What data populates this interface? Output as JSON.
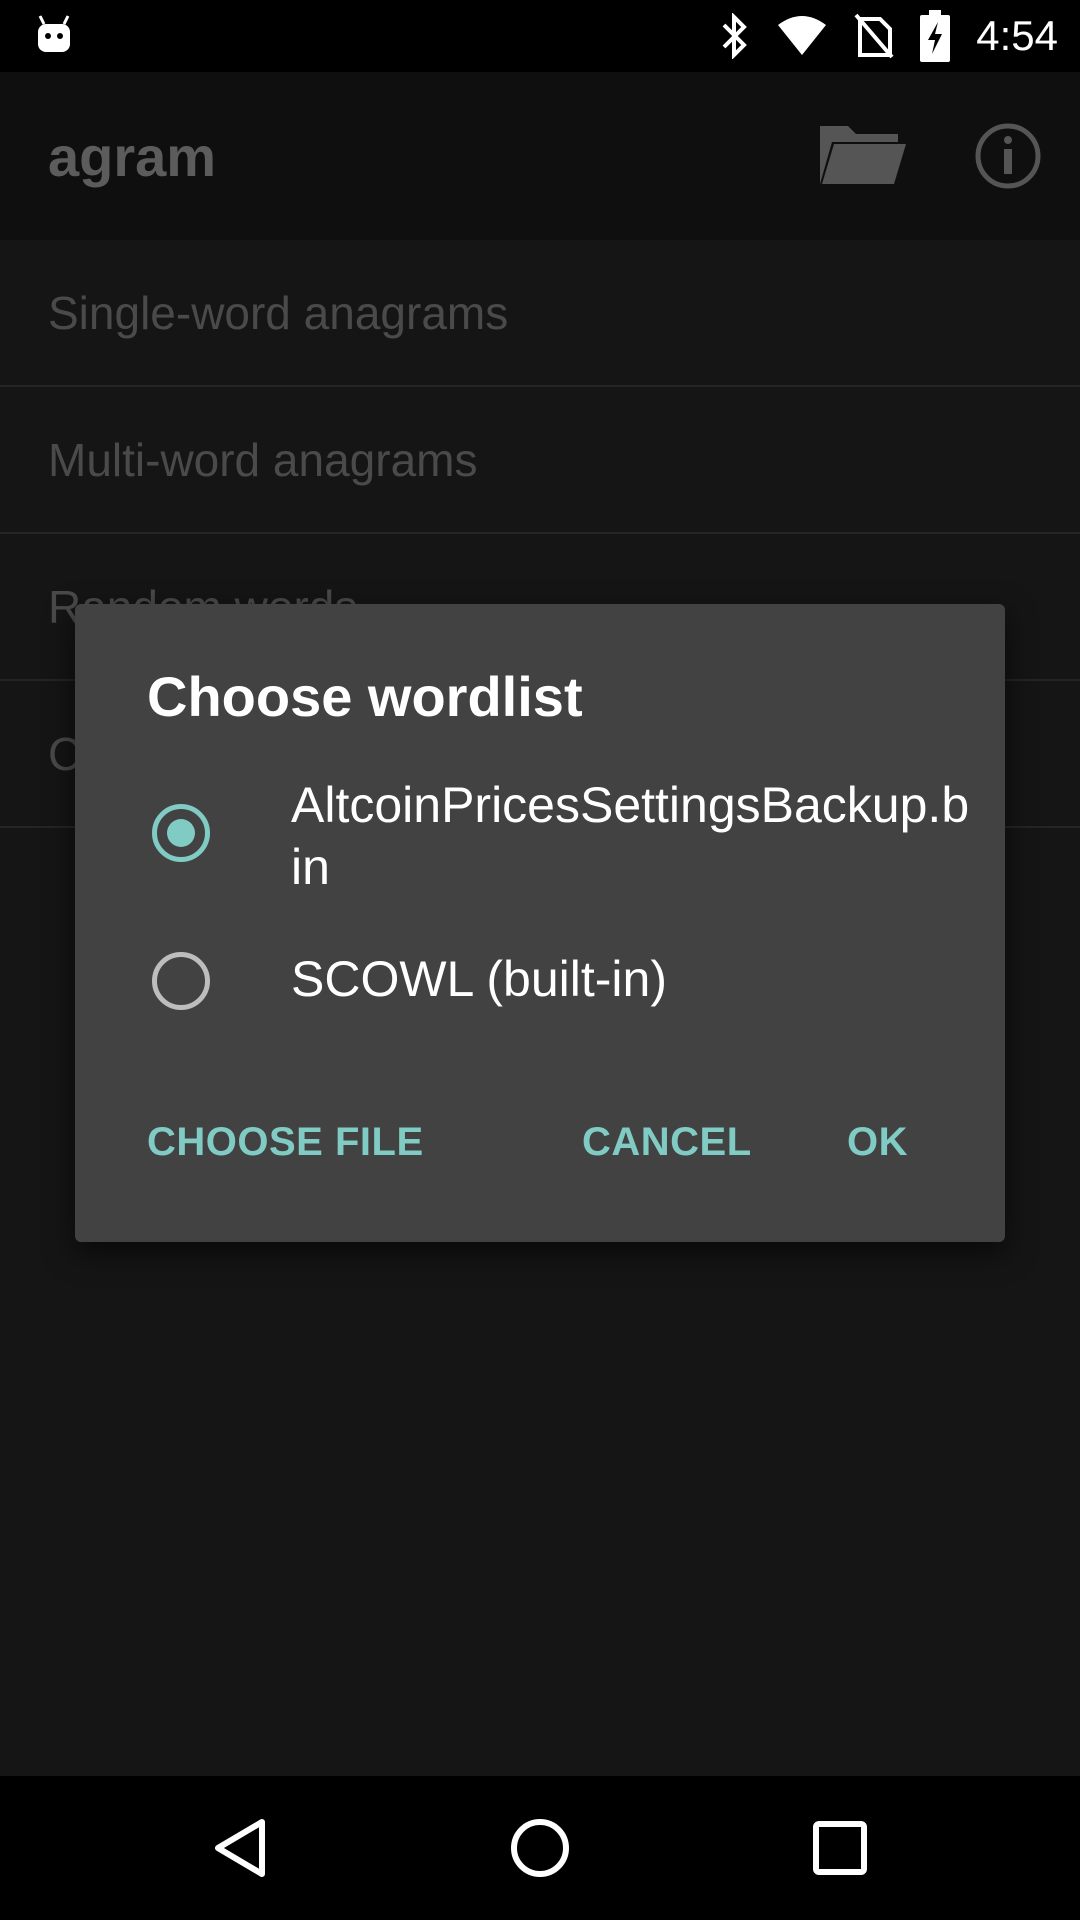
{
  "status_bar": {
    "time": "4:54",
    "icons": [
      "android-notification-icon",
      "bluetooth-icon",
      "wifi-icon",
      "no-sim-icon",
      "battery-charging-icon"
    ]
  },
  "app_bar": {
    "title": "agram",
    "actions": [
      "folder-icon",
      "info-icon"
    ]
  },
  "list": {
    "items": [
      {
        "label": "Single-word anagrams"
      },
      {
        "label": "Multi-word anagrams"
      },
      {
        "label": "Random words"
      },
      {
        "label": "C"
      }
    ]
  },
  "dialog": {
    "title": "Choose wordlist",
    "options": [
      {
        "label": "AltcoinPricesSettingsBackup.bin",
        "selected": true
      },
      {
        "label": "SCOWL (built-in)",
        "selected": false
      }
    ],
    "buttons": {
      "choose_file": "CHOOSE FILE",
      "cancel": "CANCEL",
      "ok": "OK"
    },
    "accent_color": "#80cbc4"
  },
  "nav_bar": {
    "buttons": [
      "back-icon",
      "home-icon",
      "recents-icon"
    ]
  }
}
